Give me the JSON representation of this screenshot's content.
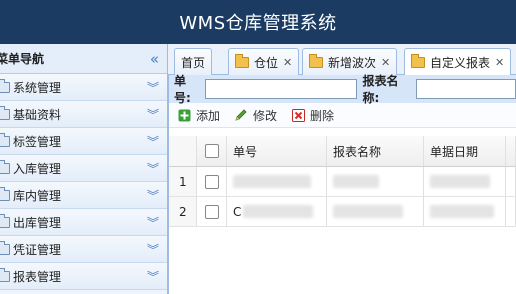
{
  "header": {
    "title": "WMS仓库管理系统"
  },
  "sidebar": {
    "title": "菜单导航",
    "items": [
      {
        "label": "系统管理"
      },
      {
        "label": "基础资料"
      },
      {
        "label": "标签管理"
      },
      {
        "label": "入库管理"
      },
      {
        "label": "库内管理"
      },
      {
        "label": "出库管理"
      },
      {
        "label": "凭证管理"
      },
      {
        "label": "报表管理"
      }
    ]
  },
  "tabs": [
    {
      "label": "首页",
      "active": false
    },
    {
      "label": "仓位",
      "active": false
    },
    {
      "label": "新增波次",
      "active": false
    },
    {
      "label": "自定义报表",
      "active": true
    }
  ],
  "search": {
    "order_no_label": "单号:",
    "report_name_label": "报表名称:",
    "order_no_value": "",
    "report_name_value": ""
  },
  "toolbar": {
    "add_label": "添加",
    "edit_label": "修改",
    "delete_label": "删除"
  },
  "table": {
    "columns": [
      "单号",
      "报表名称",
      "单据日期"
    ],
    "rows": [
      {
        "num": "1",
        "order_no": "",
        "report_name": "",
        "date": ""
      },
      {
        "num": "2",
        "order_no": "C",
        "report_name": "",
        "date": ""
      }
    ]
  },
  "colors": {
    "header_bg": "#1b3b63",
    "sidebar_bg": "#eef4fc",
    "accent": "#4a7cc0",
    "search_bg": "#d6e5f7"
  }
}
